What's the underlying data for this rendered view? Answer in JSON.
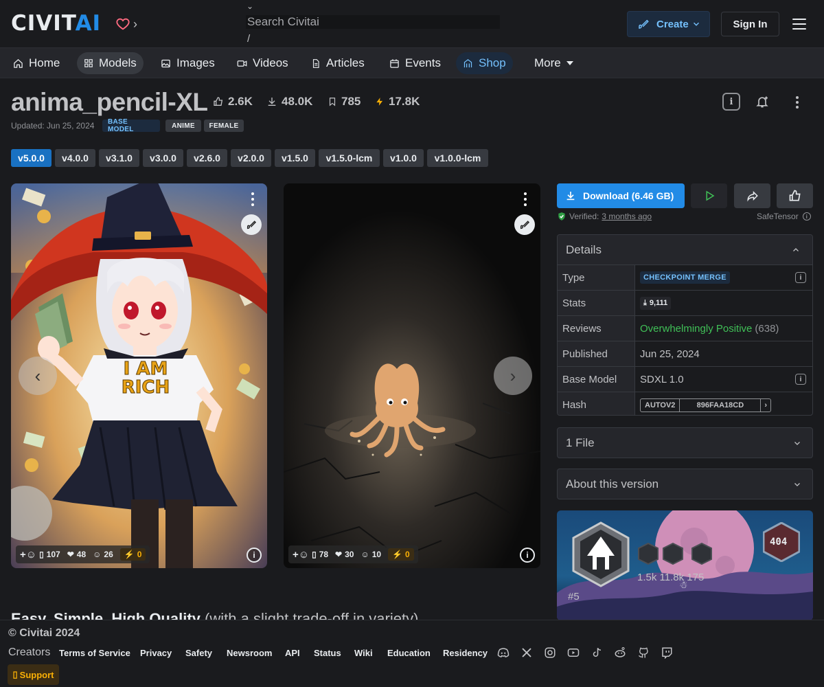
{
  "header": {
    "logo_main": "CIVIT",
    "logo_accent": "AI",
    "search_placeholder": "Search Civitai",
    "search_shortcut": "/",
    "create_label": "Create",
    "signin_label": "Sign In"
  },
  "nav": {
    "items": [
      {
        "label": "Home",
        "icon": "home-icon"
      },
      {
        "label": "Models",
        "icon": "grid-icon"
      },
      {
        "label": "Images",
        "icon": "photo-icon"
      },
      {
        "label": "Videos",
        "icon": "video-icon"
      },
      {
        "label": "Articles",
        "icon": "file-icon"
      },
      {
        "label": "Events",
        "icon": "calendar-icon"
      },
      {
        "label": "Shop",
        "icon": "shop-icon"
      },
      {
        "label": "More",
        "icon": "caret-down-icon"
      }
    ]
  },
  "model": {
    "title": "anima_pencil-XL",
    "likes": "2.6K",
    "downloads": "48.0K",
    "bookmarks": "785",
    "buzz": "17.8K",
    "updated": "Updated: Jun 25, 2024",
    "badges": [
      "BASE MODEL",
      "ANIME",
      "FEMALE"
    ]
  },
  "versions": [
    "v5.0.0",
    "v4.0.0",
    "v3.1.0",
    "v3.0.0",
    "v2.6.0",
    "v2.0.0",
    "v1.5.0",
    "v1.5.0-lcm",
    "v1.0.0",
    "v1.0.0-lcm"
  ],
  "images": [
    {
      "plus": "107",
      "hearts": "48",
      "laughs": "26",
      "buzz": "0"
    },
    {
      "plus": "78",
      "hearts": "30",
      "laughs": "10",
      "buzz": "0"
    }
  ],
  "actions": {
    "download_label": "Download (6.46 GB)",
    "verified_prefix": "Verified:",
    "verified_when": "3 months ago",
    "file_format": "SafeTensor"
  },
  "details": {
    "title": "Details",
    "rows": {
      "type_k": "Type",
      "type_v": "CHECKPOINT MERGE",
      "stats_k": "Stats",
      "stats_v": "9,111",
      "reviews_k": "Reviews",
      "reviews_v": "Overwhelmingly Positive",
      "reviews_count": "(638)",
      "published_k": "Published",
      "published_v": "Jun 25, 2024",
      "base_k": "Base Model",
      "base_v": "SDXL 1.0",
      "hash_k": "Hash",
      "hash_type": "AUTOV2",
      "hash_v": "896FAA18CD"
    }
  },
  "accordions": {
    "files": "1 File",
    "about": "About this version"
  },
  "creator_card": {
    "rank_badge": "404",
    "stats_text": "1.5k 11.8k 175",
    "rank": "#5"
  },
  "description": {
    "heading": "Easy, Simple, High Quality",
    "rest": "(with a slight trade-off in variety)"
  },
  "footer": {
    "copyright": "© Civitai 2024",
    "creators": "Creators",
    "links": [
      "Terms of Service",
      "Privacy",
      "Safety",
      "Newsroom",
      "API",
      "Status",
      "Wiki",
      "Education",
      "Residency"
    ],
    "support": "Support"
  },
  "colors": {
    "accent": "#228be6",
    "background": "#1a1b1e",
    "buzz": "#fab005",
    "positive": "#40c057"
  }
}
